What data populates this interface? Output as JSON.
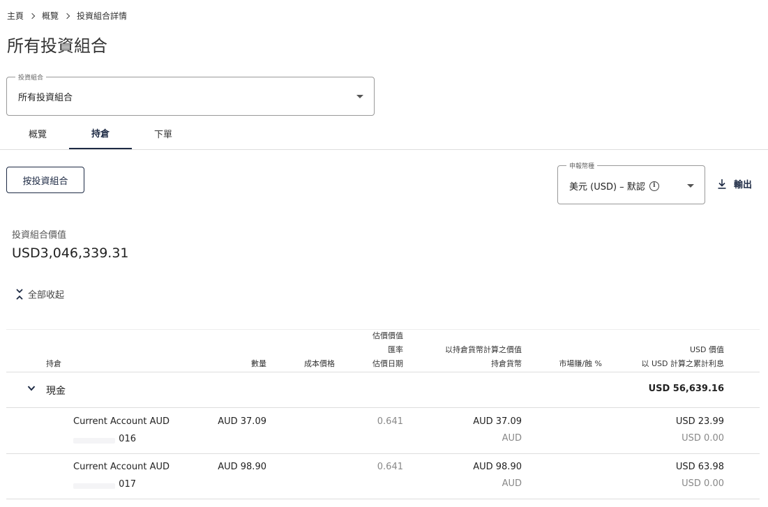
{
  "breadcrumb": [
    "主頁",
    "概覽",
    "投資組合詳情"
  ],
  "page_title": "所有投資組合",
  "portfolio_select": {
    "legend": "投資組合",
    "value": "所有投資組合"
  },
  "tabs": [
    {
      "label": "概覽",
      "active": false
    },
    {
      "label": "持倉",
      "active": true
    },
    {
      "label": "下單",
      "active": false
    }
  ],
  "by_portfolio_button": "按投資組合",
  "currency_select": {
    "legend": "申報幣種",
    "value": "美元 (USD) – 默認"
  },
  "export_label": "輸出",
  "portfolio_value": {
    "label": "投資組合價值",
    "value": "USD3,046,339.31"
  },
  "collapse_all": "全部收起",
  "table": {
    "headers": {
      "holding": "持倉",
      "quantity": "數量",
      "cost_price": "成本價格",
      "valuation_1": "估價價值",
      "valuation_2": "匯率",
      "valuation_3": "估價日期",
      "holding_ccy_1": "以持倉貨幣計算之價值",
      "holding_ccy_2": "持倉貨幣",
      "market_pl": "市場賺/蝕 %",
      "usd_1": "USD 價值",
      "usd_2": "以 USD 計算之累計利息"
    },
    "group": {
      "name": "現金",
      "total": "USD 56,639.16"
    },
    "rows": [
      {
        "name": "Current Account AUD",
        "account_suffix": "016",
        "quantity": "AUD 37.09",
        "rate": "0.641",
        "holding_value": "AUD 37.09",
        "holding_ccy": "AUD",
        "usd_value": "USD 23.99",
        "usd_interest": "USD 0.00"
      },
      {
        "name": "Current Account AUD",
        "account_suffix": "017",
        "quantity": "AUD 98.90",
        "rate": "0.641",
        "holding_value": "AUD 98.90",
        "holding_ccy": "AUD",
        "usd_value": "USD 63.98",
        "usd_interest": "USD 0.00"
      }
    ]
  }
}
